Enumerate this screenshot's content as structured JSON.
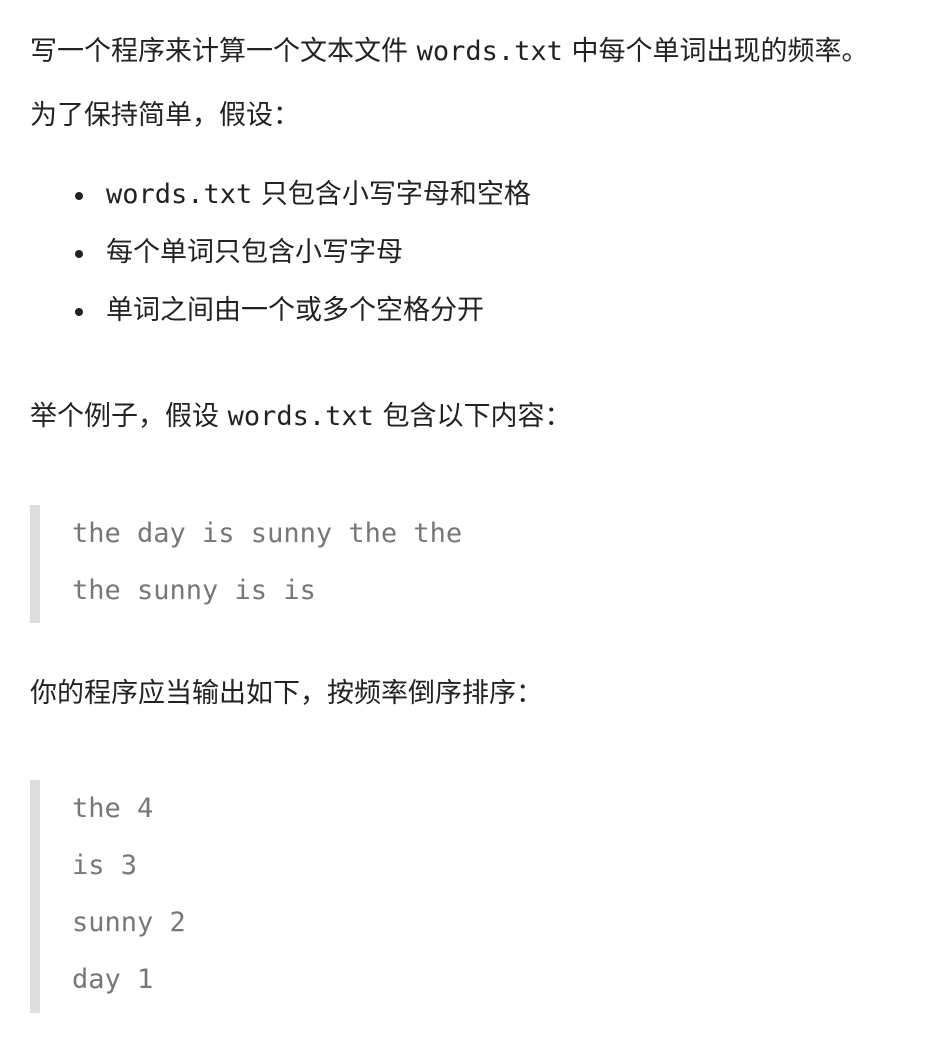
{
  "intro": {
    "before": "写一个程序来计算一个文本文件 ",
    "code": "words.txt",
    "after": " 中每个单词出现的频率。"
  },
  "assume": "为了保持简单，假设：",
  "rules": [
    {
      "code": "words.txt",
      "text": " 只包含小写字母和空格"
    },
    {
      "code": "",
      "text": "每个单词只包含小写字母"
    },
    {
      "code": "",
      "text": "单词之间由一个或多个空格分开"
    }
  ],
  "example": {
    "before": "举个例子，假设 ",
    "code": "words.txt",
    "after": " 包含以下内容："
  },
  "input_lines": [
    "the day is sunny the the",
    "the sunny is is"
  ],
  "output_intro": "你的程序应当输出如下，按频率倒序排序：",
  "output_lines": [
    "the 4",
    "is 3",
    "sunny 2",
    "day 1"
  ],
  "colors": {
    "text": "#222222",
    "code_block_text": "#777777",
    "blockquote_border": "#dddddd"
  }
}
